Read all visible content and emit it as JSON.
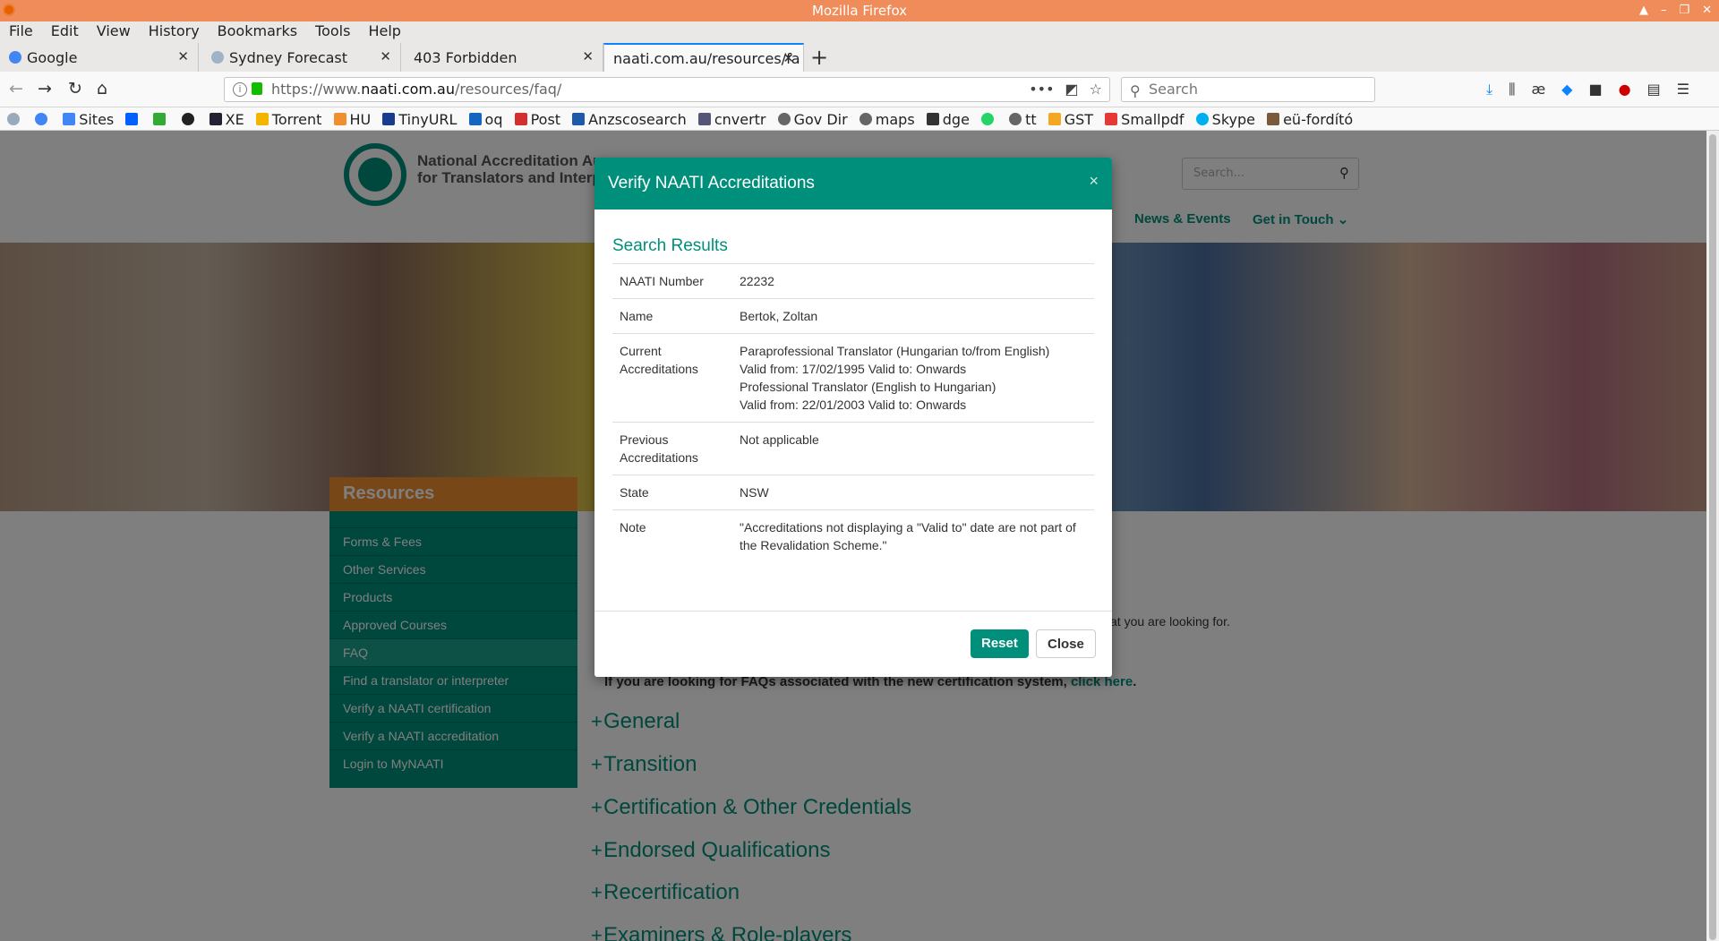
{
  "window": {
    "title": "Mozilla Firefox"
  },
  "menu": [
    "File",
    "Edit",
    "View",
    "History",
    "Bookmarks",
    "Tools",
    "Help"
  ],
  "tabs": [
    {
      "label": "Google",
      "color": "#4285f4"
    },
    {
      "label": "Sydney Forecast",
      "color": "#8ab"
    },
    {
      "label": "403 Forbidden",
      "color": ""
    },
    {
      "label": "naati.com.au/resources/fa",
      "color": ""
    }
  ],
  "url": {
    "prefix": "https://www.",
    "host": "naati.com.au",
    "path": "/resources/faq/"
  },
  "search": {
    "placeholder": "Search"
  },
  "bookmarks": [
    "Sites",
    "XE",
    "Torrent",
    "HU",
    "TinyURL",
    "oq",
    "Post",
    "Anzscosearch",
    "cnvertr",
    "Gov Dir",
    "maps",
    "dge",
    "tt",
    "GST",
    "Smallpdf",
    "Skype",
    "eü-fordító"
  ],
  "site": {
    "logo_line1": "National Accreditation Au",
    "logo_line2": "for Translators and Interp",
    "search_placeholder": "Search...",
    "nav": [
      "News & Events",
      "Get in Touch ⌄"
    ]
  },
  "sidebar": {
    "title": "Resources",
    "items": [
      "Forms & Fees",
      "Other Services",
      "Products",
      "Approved Courses",
      "FAQ",
      "Find a translator or interpreter",
      "Verify a NAATI certification",
      "Verify a NAATI accreditation",
      "Login to MyNAATI"
    ]
  },
  "faq": {
    "intro": "at you are looking for.",
    "cert_text": "If you are looking for FAQs associated with the new certification system, ",
    "cert_link": "click here",
    "cert_end": ".",
    "categories": [
      "General",
      "Transition",
      "Certification & Other Credentials",
      "Endorsed Qualifications",
      "Recertification",
      "Examiners & Role-players"
    ]
  },
  "modal": {
    "title": "Verify NAATI Accreditations",
    "close_x": "×",
    "results_title": "Search Results",
    "rows": [
      {
        "label": "NAATI Number",
        "value": [
          "22232"
        ]
      },
      {
        "label": "Name",
        "value": [
          "Bertok, Zoltan"
        ]
      },
      {
        "label": "Current Accreditations",
        "value": [
          "Paraprofessional Translator (Hungarian to/from English)",
          "Valid from: 17/02/1995 Valid to: Onwards",
          "Professional Translator (English to Hungarian)",
          "Valid from: 22/01/2003 Valid to: Onwards"
        ]
      },
      {
        "label": "Previous Accreditations",
        "value": [
          "Not applicable"
        ]
      },
      {
        "label": "State",
        "value": [
          "NSW"
        ]
      },
      {
        "label": "Note",
        "value": [
          "\"Accreditations not displaying a \"Valid to\" date are not part of the Revalidation Scheme.\""
        ]
      }
    ],
    "reset_label": "Reset",
    "close_label": "Close"
  },
  "colors": {
    "accent": "#008f7a",
    "orange": "#f08f2f",
    "titlebar": "#ef8c5a"
  }
}
